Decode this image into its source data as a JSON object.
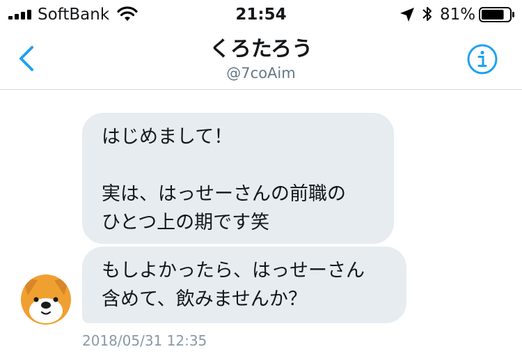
{
  "status_bar": {
    "carrier": "SoftBank",
    "time": "21:54",
    "battery_percent": "81%",
    "battery_level": 0.81,
    "icons": [
      "signal-icon",
      "wifi-icon",
      "location-arrow-icon",
      "bluetooth-icon",
      "battery-icon"
    ]
  },
  "nav": {
    "title": "くろたろう",
    "handle": "@7coAim",
    "icons": [
      "chevron-left-icon",
      "info-icon"
    ],
    "accent_color": "#1da1f2"
  },
  "messages": [
    {
      "lines": [
        "はじめまして！",
        "",
        "実は、はっせーさんの前職の",
        "ひとつ上の期です笑"
      ]
    },
    {
      "lines": [
        "もしよかったら、はっせーさん",
        "含めて、飲みませんか？"
      ]
    }
  ],
  "timestamp": "2018/05/31 12:35",
  "colors": {
    "bubble": "#e6ecf0",
    "meta_text": "#8899a6",
    "avatar": "#f0a030"
  }
}
